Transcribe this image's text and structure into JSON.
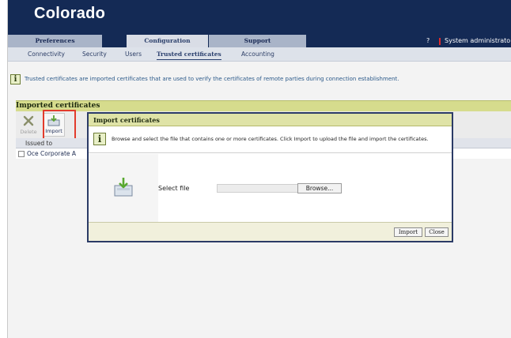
{
  "app": {
    "title": "Colorado"
  },
  "main_tabs": [
    {
      "label": "Preferences",
      "active": false
    },
    {
      "label": "Configuration",
      "active": true
    },
    {
      "label": "Support",
      "active": false
    }
  ],
  "header_right": {
    "help": "?",
    "user": "System administrato"
  },
  "sub_tabs": [
    {
      "label": "Connectivity",
      "active": false
    },
    {
      "label": "Security",
      "active": false
    },
    {
      "label": "Users",
      "active": false
    },
    {
      "label": "Trusted certificates",
      "active": true
    },
    {
      "label": "Accounting",
      "active": false
    }
  ],
  "page_info": "Trusted certificates are imported certificates that are used to verify the certificates of remote parties during connection establishment.",
  "panel": {
    "title": "Imported certificates",
    "toolbar": {
      "delete_label": "Delete",
      "import_label": "Import"
    },
    "column_header": "Issued to",
    "rows": [
      {
        "issued_to": "Oce Corporate A",
        "checked": false
      }
    ]
  },
  "dialog": {
    "title": "Import certificates",
    "info": "Browse and select the file that contains one or more certificates. Click Import to upload the file and import the certificates.",
    "select_file_label": "Select file",
    "file_value": "",
    "browse_label": "Browse...",
    "import_label": "Import",
    "close_label": "Close"
  },
  "colors": {
    "header_bg": "#142a55",
    "tab_bg": "#a9b4c8",
    "panel_header": "#d6dc8d",
    "highlight": "#e23c2c"
  }
}
